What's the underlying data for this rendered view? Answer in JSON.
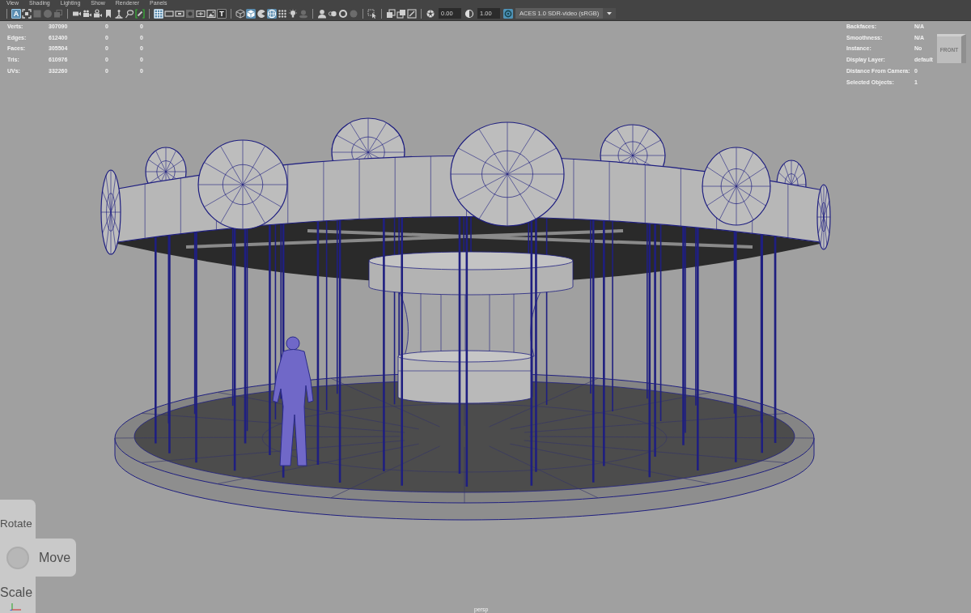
{
  "menu_bar": [
    "View",
    "Shading",
    "Lighting",
    "Show",
    "Renderer",
    "Panels"
  ],
  "toolbar": {
    "groups": [
      [
        {
          "kind": "letter",
          "label": "A",
          "on": true,
          "disabled": false
        },
        {
          "kind": "frame",
          "on": false,
          "disabled": false
        },
        {
          "kind": "square",
          "on": false,
          "disabled": true
        },
        {
          "kind": "sphere",
          "on": false,
          "disabled": true
        },
        {
          "kind": "layers",
          "on": false,
          "disabled": true
        }
      ],
      [
        {
          "kind": "camera",
          "on": false,
          "disabled": false
        },
        {
          "kind": "camerareel",
          "on": false,
          "disabled": false
        },
        {
          "kind": "cameragear",
          "on": false,
          "disabled": false
        },
        {
          "kind": "bookmark",
          "on": false,
          "disabled": false
        },
        {
          "kind": "easel",
          "on": false,
          "disabled": false
        },
        {
          "kind": "lasso",
          "on": false,
          "disabled": false
        },
        {
          "kind": "pencil",
          "on": false,
          "disabled": false
        }
      ],
      [
        {
          "kind": "grid",
          "on": true,
          "disabled": false
        },
        {
          "kind": "gate",
          "on": false,
          "disabled": false
        },
        {
          "kind": "resgate",
          "on": false,
          "disabled": false
        },
        {
          "kind": "mask",
          "on": false,
          "disabled": true
        },
        {
          "kind": "crosshair",
          "on": false,
          "disabled": false
        },
        {
          "kind": "image",
          "on": false,
          "disabled": false
        },
        {
          "kind": "letter",
          "label": "T",
          "on": false,
          "disabled": false
        }
      ],
      [
        {
          "kind": "wirecube",
          "on": false,
          "disabled": false
        },
        {
          "kind": "solidcube",
          "on": true,
          "disabled": false
        },
        {
          "kind": "pieball",
          "on": false,
          "disabled": false
        },
        {
          "kind": "wiresphere",
          "on": true,
          "disabled": false
        },
        {
          "kind": "dots",
          "on": false,
          "disabled": false
        },
        {
          "kind": "bulb",
          "on": false,
          "disabled": false
        },
        {
          "kind": "shadow",
          "on": false,
          "disabled": true
        }
      ],
      [
        {
          "kind": "bust",
          "on": false,
          "disabled": false
        },
        {
          "kind": "blur",
          "on": false,
          "disabled": false
        },
        {
          "kind": "ring",
          "on": false,
          "disabled": false
        },
        {
          "kind": "lens",
          "on": false,
          "disabled": true
        }
      ],
      [
        {
          "kind": "cursor",
          "on": false,
          "disabled": false
        }
      ],
      [
        {
          "kind": "xray",
          "on": false,
          "disabled": false
        },
        {
          "kind": "xrayoutline",
          "on": false,
          "disabled": false
        },
        {
          "kind": "bone",
          "on": false,
          "disabled": false
        }
      ]
    ],
    "exposure": "0.00",
    "gamma": "1.00",
    "color_management": {
      "on": true
    },
    "view_transform": "ACES 1.0 SDR-video (sRGB)"
  },
  "hud_left": [
    {
      "label": "Verts:",
      "values": [
        "307090",
        "0",
        "0"
      ]
    },
    {
      "label": "Edges:",
      "values": [
        "612400",
        "0",
        "0"
      ]
    },
    {
      "label": "Faces:",
      "values": [
        "305504",
        "0",
        "0"
      ]
    },
    {
      "label": "Tris:",
      "values": [
        "610976",
        "0",
        "0"
      ]
    },
    {
      "label": "UVs:",
      "values": [
        "332260",
        "0",
        "0"
      ]
    }
  ],
  "hud_right": [
    {
      "label": "Backfaces:",
      "value": "N/A"
    },
    {
      "label": "Smoothness:",
      "value": "N/A"
    },
    {
      "label": "Instance:",
      "value": "No"
    },
    {
      "label": "Display Layer:",
      "value": "default"
    },
    {
      "label": "Distance From Camera:",
      "value": "0"
    },
    {
      "label": "Selected Objects:",
      "value": "1"
    }
  ],
  "view_cube": {
    "label": "FRONT"
  },
  "nav_gizmo": {
    "buttons": [
      "Rotate",
      "Move",
      "Scale"
    ]
  },
  "camera_label": "persp"
}
